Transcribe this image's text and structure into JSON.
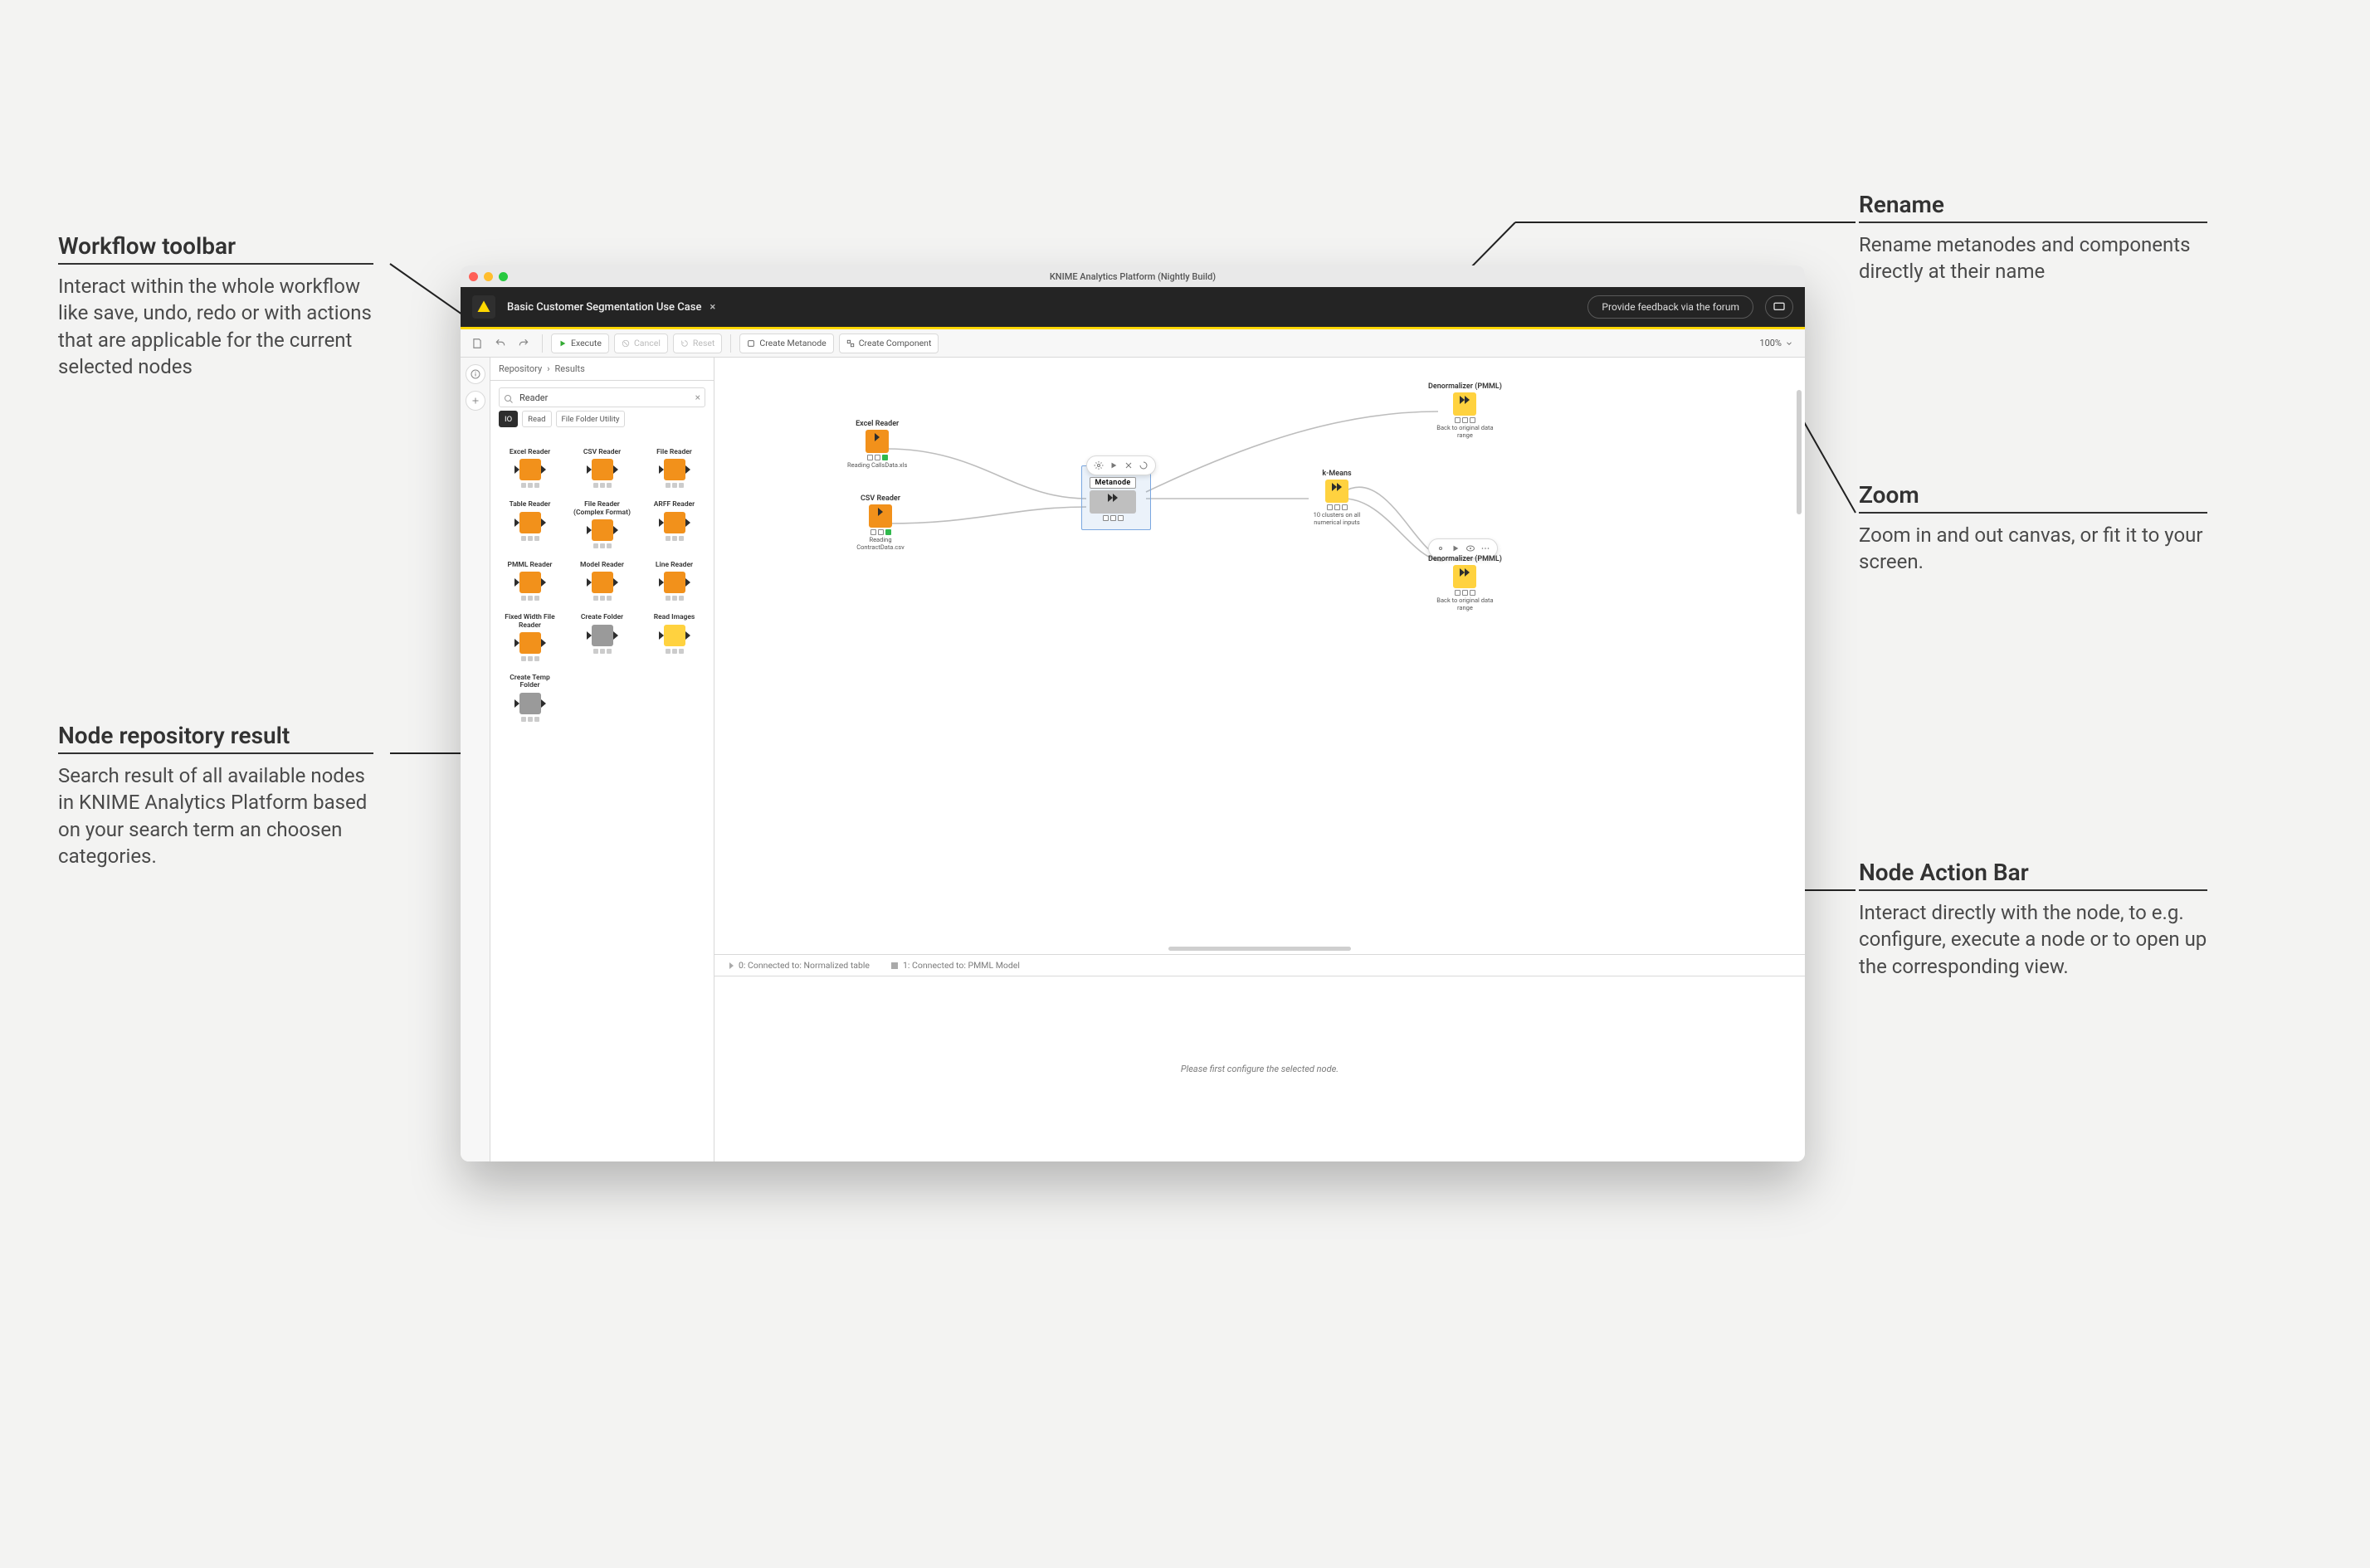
{
  "callouts": {
    "toolbar": {
      "title": "Workflow toolbar",
      "body": "Interact within the whole workflow like save, undo, redo or with actions that are applicable for the current selected nodes"
    },
    "repo": {
      "title": "Node repository result",
      "body": "Search result of all available nodes in KNIME Analytics Platform based on your search term an choosen categories."
    },
    "rename": {
      "title": "Rename",
      "body": "Rename metanodes and components directly at their name"
    },
    "zoom": {
      "title": "Zoom",
      "body": "Zoom in and out canvas, or fit it to your screen."
    },
    "actionbar": {
      "title": "Node Action Bar",
      "body": "Interact directly with the node, to e.g. configure, execute a node or to open up the corresponding view."
    }
  },
  "window": {
    "title": "KNIME Analytics Platform (Nightly Build)"
  },
  "appbar": {
    "workflow_tab": "Basic Customer Segmentation Use Case",
    "close_glyph": "×",
    "feedback": "Provide feedback via the forum"
  },
  "toolbar": {
    "execute": "Execute",
    "cancel": "Cancel",
    "reset": "Reset",
    "create_metanode": "Create Metanode",
    "create_component": "Create Component",
    "zoom": "100%"
  },
  "repo": {
    "breadcrumb": [
      "Repository",
      "Results"
    ],
    "search_value": "Reader",
    "search_placeholder": "Reader",
    "tags": [
      {
        "label": "IO",
        "dark": true
      },
      {
        "label": "Read",
        "dark": false
      },
      {
        "label": "File Folder Utility",
        "dark": false
      }
    ],
    "nodes": [
      {
        "name": "Excel Reader",
        "color": "orange"
      },
      {
        "name": "CSV Reader",
        "color": "orange"
      },
      {
        "name": "File Reader",
        "color": "orange"
      },
      {
        "name": "Table Reader",
        "color": "orange"
      },
      {
        "name": "File Reader (Complex Format)",
        "color": "orange"
      },
      {
        "name": "ARFF Reader",
        "color": "orange"
      },
      {
        "name": "PMML Reader",
        "color": "orange"
      },
      {
        "name": "Model Reader",
        "color": "orange"
      },
      {
        "name": "Line Reader",
        "color": "orange"
      },
      {
        "name": "Fixed Width File Reader",
        "color": "orange"
      },
      {
        "name": "Create Folder",
        "color": "grey"
      },
      {
        "name": "Read Images",
        "color": "yellow"
      },
      {
        "name": "Create Temp Folder",
        "color": "grey"
      }
    ]
  },
  "canvas": {
    "nodes": {
      "excel": {
        "title": "Excel Reader",
        "subtitle": "Reading CallsData.xls"
      },
      "csv": {
        "title": "CSV Reader",
        "subtitle": "Reading ContractData.csv"
      },
      "metanode": {
        "label": "Metanode"
      },
      "kmeans": {
        "title": "k-Means",
        "subtitle": "10 clusters on all numerical inputs"
      },
      "denorm1": {
        "title": "Denormalizer (PMML)",
        "subtitle": "Back to original data range"
      },
      "denorm2": {
        "title": "Denormalizer (PMML)",
        "subtitle": "Back to original data range"
      }
    }
  },
  "ports": {
    "0": "0: Connected to: Normalized table",
    "1": "1: Connected to: PMML Model",
    "placeholder": "Please first configure the selected node."
  }
}
